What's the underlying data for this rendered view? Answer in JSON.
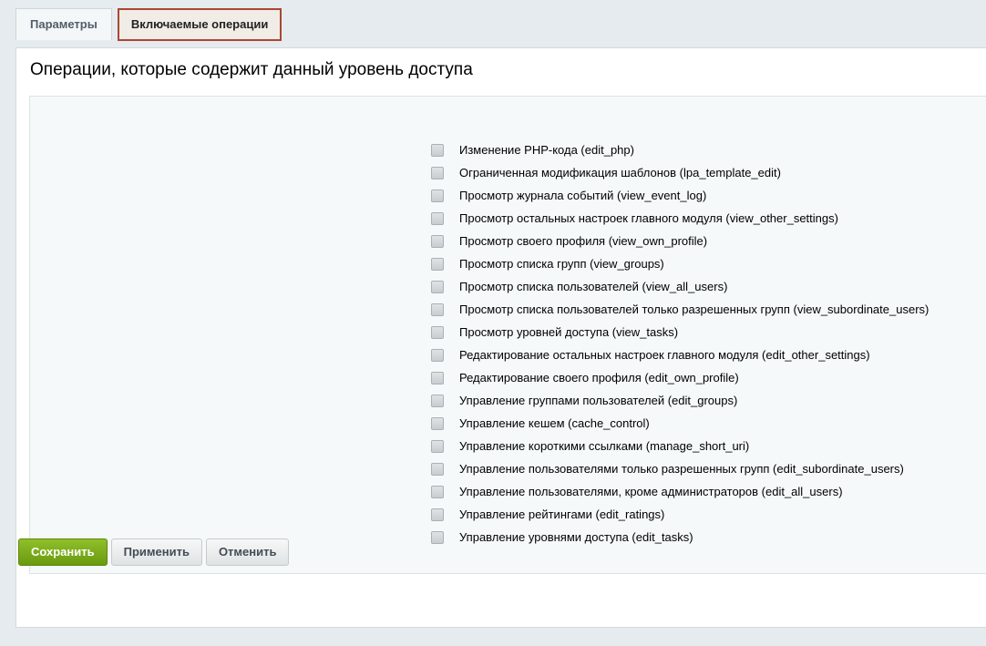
{
  "tabs": [
    {
      "label": "Параметры",
      "active": false
    },
    {
      "label": "Включаемые операции",
      "active": true
    }
  ],
  "title": "Операции, которые содержит данный уровень доступа",
  "operations": [
    {
      "label": "Изменение PHP-кода (edit_php)",
      "checked": false
    },
    {
      "label": "Ограниченная модификация шаблонов (lpa_template_edit)",
      "checked": false
    },
    {
      "label": "Просмотр журнала событий (view_event_log)",
      "checked": false
    },
    {
      "label": "Просмотр остальных настроек главного модуля (view_other_settings)",
      "checked": false
    },
    {
      "label": "Просмотр своего профиля (view_own_profile)",
      "checked": false
    },
    {
      "label": "Просмотр списка групп (view_groups)",
      "checked": false
    },
    {
      "label": "Просмотр списка пользователей (view_all_users)",
      "checked": false
    },
    {
      "label": "Просмотр списка пользователей только разрешенных групп (view_subordinate_users)",
      "checked": false
    },
    {
      "label": "Просмотр уровней доступа (view_tasks)",
      "checked": false
    },
    {
      "label": "Редактирование остальных настроек главного модуля (edit_other_settings)",
      "checked": false
    },
    {
      "label": "Редактирование своего профиля (edit_own_profile)",
      "checked": false
    },
    {
      "label": "Управление группами пользователей (edit_groups)",
      "checked": false
    },
    {
      "label": "Управление кешем (cache_control)",
      "checked": false
    },
    {
      "label": "Управление короткими ссылками (manage_short_uri)",
      "checked": false
    },
    {
      "label": "Управление пользователями только разрешенных групп (edit_subordinate_users)",
      "checked": false
    },
    {
      "label": "Управление пользователями, кроме администраторов (edit_all_users)",
      "checked": false
    },
    {
      "label": "Управление рейтингами (edit_ratings)",
      "checked": false
    },
    {
      "label": "Управление уровнями доступа (edit_tasks)",
      "checked": false
    }
  ],
  "buttons": {
    "save": "Сохранить",
    "apply": "Применить",
    "cancel": "Отменить"
  },
  "colors": {
    "active_tab_border": "#a94733",
    "save_button": "#7aac1b",
    "background": "#e5ebee"
  }
}
